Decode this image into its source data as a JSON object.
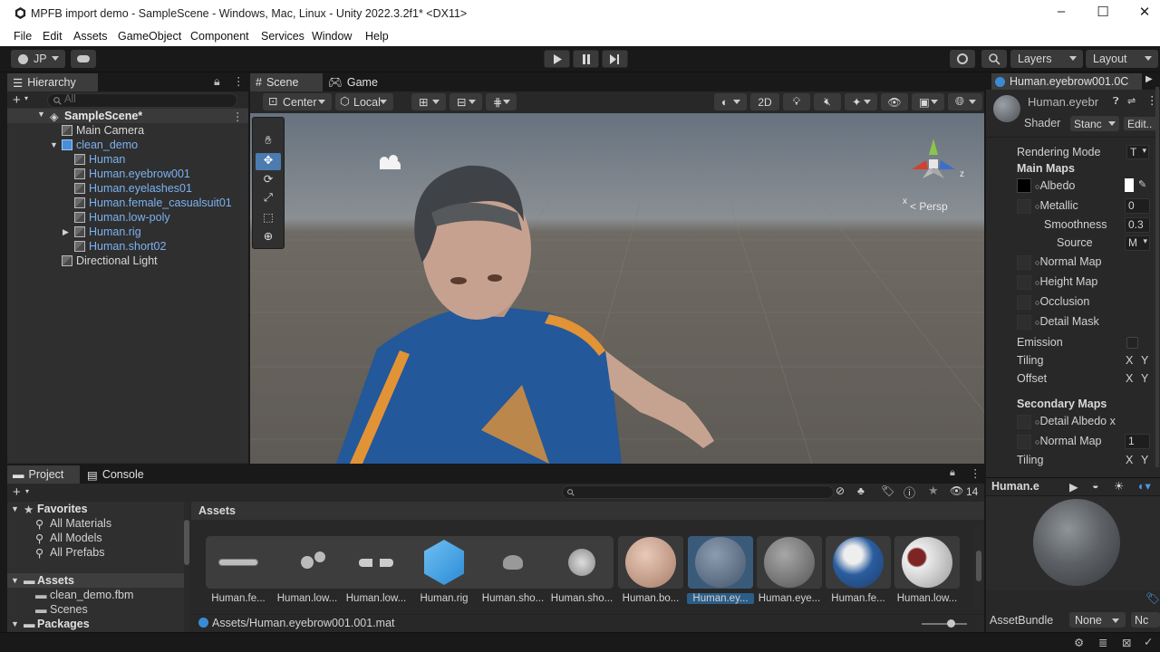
{
  "window": {
    "title": "MPFB import demo - SampleScene - Windows, Mac, Linux - Unity 2022.3.2f1* <DX11>"
  },
  "menu": [
    "File",
    "Edit",
    "Assets",
    "GameObject",
    "Component",
    "Services",
    "Window",
    "Help"
  ],
  "toolbar": {
    "account": "JP",
    "layers": "Layers",
    "layout": "Layout"
  },
  "hierarchy": {
    "tab": "Hierarchy",
    "search_placeholder": "All",
    "scene": "SampleScene*",
    "items": [
      {
        "label": "Main Camera",
        "indent": 1,
        "color": "white"
      },
      {
        "label": "clean_demo",
        "indent": 1,
        "color": "blue"
      },
      {
        "label": "Human",
        "indent": 2,
        "color": "blue"
      },
      {
        "label": "Human.eyebrow001",
        "indent": 2,
        "color": "blue"
      },
      {
        "label": "Human.eyelashes01",
        "indent": 2,
        "color": "blue"
      },
      {
        "label": "Human.female_casualsuit01",
        "indent": 2,
        "color": "blue"
      },
      {
        "label": "Human.low-poly",
        "indent": 2,
        "color": "blue"
      },
      {
        "label": "Human.rig",
        "indent": 2,
        "color": "blue"
      },
      {
        "label": "Human.short02",
        "indent": 2,
        "color": "blue"
      },
      {
        "label": "Directional Light",
        "indent": 1,
        "color": "white"
      }
    ]
  },
  "scene_view": {
    "tabs": [
      "Scene",
      "Game"
    ],
    "pivot": "Center",
    "space": "Local",
    "mode2d": "2D",
    "persp": "< Persp",
    "axis_x": "x",
    "axis_z": "z"
  },
  "inspector": {
    "object": "Human.eyebrow001.0C",
    "name": "Human.eyebr",
    "shader_label": "Shader",
    "shader": "Stanc",
    "edit": "Edit..",
    "rendering_mode_label": "Rendering Mode",
    "rendering_mode": "T",
    "main_maps": "Main Maps",
    "albedo": "Albedo",
    "metallic": "Metallic",
    "metallic_val": "0",
    "smoothness": "Smoothness",
    "smoothness_val": "0.3",
    "source": "Source",
    "source_val": "M",
    "normal_map": "Normal Map",
    "height_map": "Height Map",
    "occlusion": "Occlusion",
    "detail_mask": "Detail Mask",
    "emission": "Emission",
    "tiling": "Tiling",
    "offset": "Offset",
    "x": "X",
    "y": "Y",
    "secondary_maps": "Secondary Maps",
    "detail_albedo": "Detail Albedo x",
    "normal_map2": "Normal Map",
    "normal_map2_val": "1",
    "tiling2": "Tiling",
    "preview_name": "Human.e",
    "assetbundle_label": "AssetBundle",
    "assetbundle": "None",
    "assetbundle2": "Nc"
  },
  "project": {
    "tabs": [
      "Project",
      "Console"
    ],
    "favorites": "Favorites",
    "fav_items": [
      "All Materials",
      "All Models",
      "All Prefabs"
    ],
    "assets_root": "Assets",
    "asset_folders": [
      "clean_demo.fbm",
      "Scenes"
    ],
    "packages": "Packages",
    "breadcrumb": "Assets",
    "hidden_count": "14",
    "assets": [
      {
        "label": "Human.fe...",
        "kind": "mesh-eyebrow"
      },
      {
        "label": "Human.low...",
        "kind": "mesh-eyes"
      },
      {
        "label": "Human.low...",
        "kind": "mesh-lowpoly"
      },
      {
        "label": "Human.rig",
        "kind": "prefab"
      },
      {
        "label": "Human.sho...",
        "kind": "mesh-hair"
      },
      {
        "label": "Human.sho...",
        "kind": "mesh-grey"
      },
      {
        "label": "Human.bo...",
        "kind": "mat-skin"
      },
      {
        "label": "Human.ey...",
        "kind": "mat-eyebrow",
        "selected": true
      },
      {
        "label": "Human.eye...",
        "kind": "mat-grey"
      },
      {
        "label": "Human.fe...",
        "kind": "mat-blue"
      },
      {
        "label": "Human.low...",
        "kind": "mat-eye"
      }
    ],
    "path": "Assets/Human.eyebrow001.001.mat"
  },
  "colors": {
    "accent": "#2c5d87",
    "selected_row": "#2c5d87",
    "blue_text": "#7bb2f0",
    "panel": "#282828",
    "toolbar": "#191919"
  }
}
